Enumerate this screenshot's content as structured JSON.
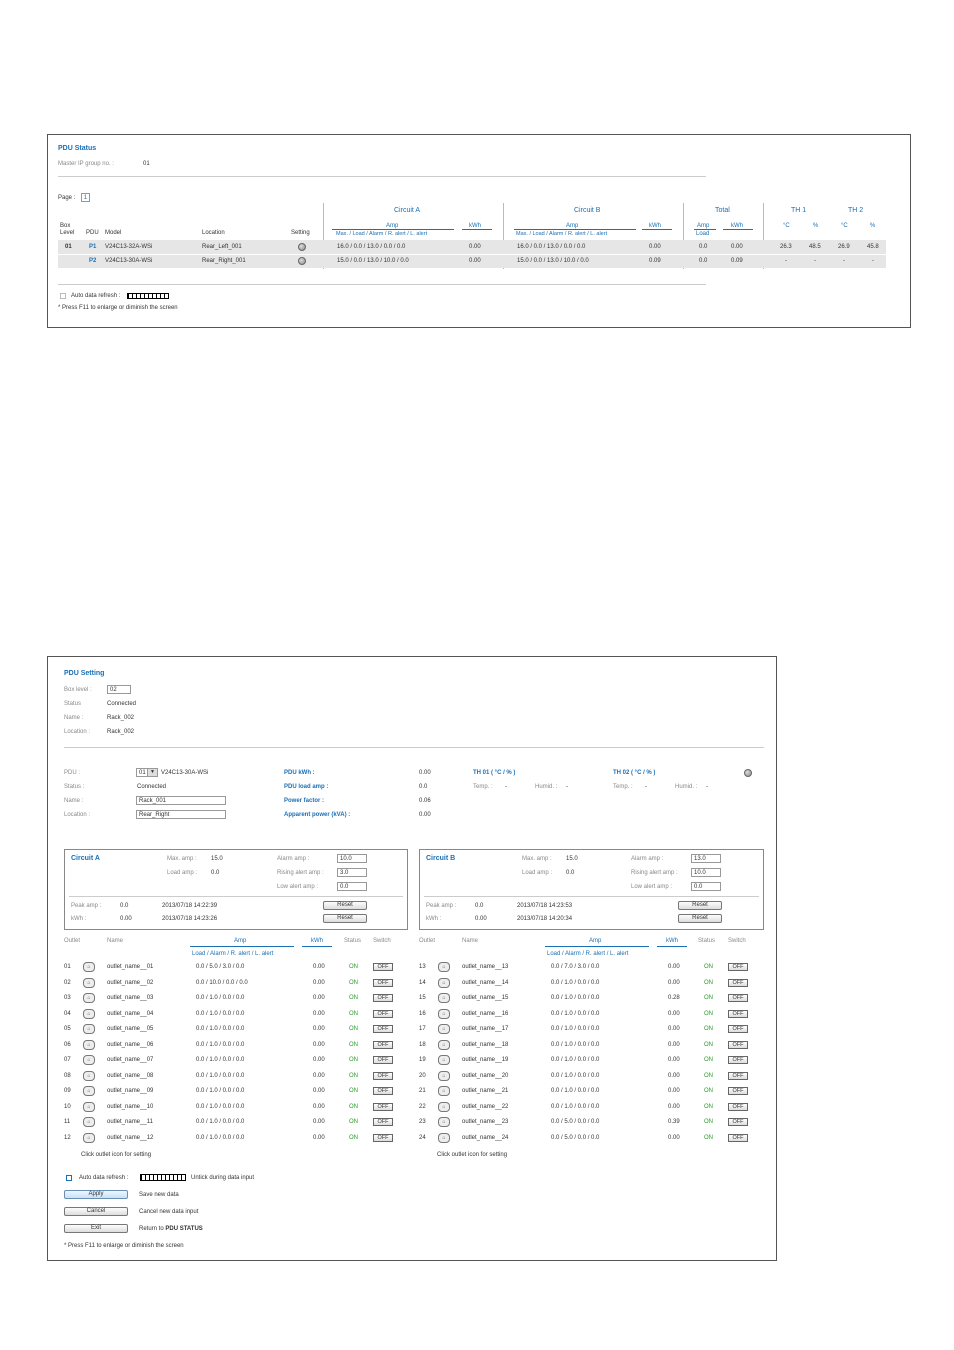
{
  "status": {
    "title": "PDU  Status",
    "master_ip_label": "Master  IP  group  no. :",
    "master_ip_value": "01",
    "page_label": "Page :",
    "page_value": "1",
    "circuit_a": "Circuit   A",
    "circuit_b": "Circuit   B",
    "total": "Total",
    "th1": "TH   1",
    "th2": "TH   2",
    "amp": "Amp",
    "kwh": "kWh",
    "amp_sub": "Max.  /  Load  / Alarm / R. alert / L. alert",
    "total_amp": "Amp",
    "total_load": "Load",
    "deg": "°C",
    "pct": "%",
    "col_box": "Box",
    "col_level": "Level",
    "col_pdu": "PDU",
    "col_model": "Model",
    "col_location": "Location",
    "col_setting": "Setting",
    "rows": [
      {
        "box": "01",
        "pdu": "P1",
        "model": "V24C13-32A-WSi",
        "location": "Rear_Left_001",
        "a_amp": "16.0   /   0.0   /  13.0   /   0.0   /   0.0",
        "a_kwh": "0.00",
        "b_amp": "16.0   /   0.0   /  13.0   /   0.0   /   0.0",
        "b_kwh": "0.00",
        "t_amp": "0.0",
        "t_kwh": "0.00",
        "th1c": "26.3",
        "th1p": "48.5",
        "th2c": "26.9",
        "th2p": "45.8"
      },
      {
        "box": "",
        "pdu": "P2",
        "model": "V24C13-30A-WSi",
        "location": "Rear_Right_001",
        "a_amp": "15.0   /   0.0   /  13.0   /  10.0   /   0.0",
        "a_kwh": "0.00",
        "b_amp": "15.0   /   0.0   /  13.0   /  10.0   /   0.0",
        "b_kwh": "0.09",
        "t_amp": "0.0",
        "t_kwh": "0.09",
        "th1c": "-",
        "th1p": "-",
        "th2c": "-",
        "th2p": "-"
      }
    ],
    "auto_refresh": "Auto data refresh :",
    "f11_note": "* Press F11 to enlarge or diminish the screen"
  },
  "setting": {
    "title": "PDU   Setting",
    "box_level_label": "Box level :",
    "box_level_value": "02",
    "status_label": "Status",
    "status_value": "Connected",
    "name_label": "Name :",
    "name_value": "Rack_002",
    "location_label": "Location :",
    "location_value": "Rack_002",
    "pdu_label": "PDU :",
    "pdu_select": "01",
    "pdu_model": "V24C13-30A-WSi",
    "pdu_status_label": "Status :",
    "pdu_status_value": "Connected",
    "pdu_name_label": "Name :",
    "pdu_name_value": "Rack_001",
    "pdu_location_label": "Location :",
    "pdu_location_value": "Rear_Right",
    "pdu_kwh_label": "PDU kWh :",
    "pdu_kwh_value": "0.00",
    "pdu_load_label": "PDU load amp :",
    "pdu_load_value": "0.0",
    "power_factor_label": "Power factor :",
    "power_factor_value": "0.06",
    "apparent_label": "Apparent power (kVA) :",
    "apparent_value": "0.00",
    "th01_label": "TH  01     ( °C   /   % )",
    "th02_label": "TH  02     ( °C   /   % )",
    "temp_label": "Temp. :",
    "temp_value": "-",
    "humid_label": "Humid. :",
    "humid_value": "-",
    "circuit_a": {
      "title": "Circuit A",
      "max_label": "Max. amp :",
      "max_value": "15.0",
      "load_label": "Load amp :",
      "load_value": "0.0",
      "alarm_label": "Alarm amp :",
      "alarm_value": "10.0",
      "rising_label": "Rising alert amp :",
      "rising_value": "3.0",
      "low_label": "Low alert amp :",
      "low_value": "0.0",
      "peak_label": "Peak amp :",
      "peak_value": "0.0",
      "peak_time": "2013/07/18 14:22:39",
      "kwh_label": "kWh :",
      "kwh_value": "0.00",
      "kwh_time": "2013/07/18 14:23:26",
      "reset": "Reset"
    },
    "circuit_b": {
      "title": "Circuit B",
      "max_label": "Max. amp :",
      "max_value": "15.0",
      "load_label": "Load amp :",
      "load_value": "0.0",
      "alarm_label": "Alarm amp :",
      "alarm_value": "13.0",
      "rising_label": "Rising alert amp :",
      "rising_value": "10.0",
      "low_label": "Low alert amp :",
      "low_value": "0.0",
      "peak_label": "Peak amp :",
      "peak_value": "0.0",
      "peak_time": "2013/07/18 14:23:53",
      "kwh_label": "kWh :",
      "kwh_value": "0.00",
      "kwh_time": "2013/07/18 14:20:34",
      "reset": "Reset"
    },
    "outlet_headers": {
      "outlet": "Outlet",
      "name": "Name",
      "amp": "Amp",
      "amp_sub": "Load / Alarm / R. alert / L. alert",
      "kwh": "kWh",
      "status": "Status",
      "switch": "Switch"
    },
    "outlets_left": [
      {
        "no": "01",
        "name": "outlet_name__01",
        "amp": "0.0   /   5.0   /   3.0   /   0.0",
        "kwh": "0.00",
        "status": "ON",
        "sw": "OFF"
      },
      {
        "no": "02",
        "name": "outlet_name__02",
        "amp": "0.0   /  10.0  /   0.0   /   0.0",
        "kwh": "0.00",
        "status": "ON",
        "sw": "OFF"
      },
      {
        "no": "03",
        "name": "outlet_name__03",
        "amp": "0.0   /   1.0   /   0.0   /   0.0",
        "kwh": "0.00",
        "status": "ON",
        "sw": "OFF"
      },
      {
        "no": "04",
        "name": "outlet_name__04",
        "amp": "0.0   /   1.0   /   0.0   /   0.0",
        "kwh": "0.00",
        "status": "ON",
        "sw": "OFF"
      },
      {
        "no": "05",
        "name": "outlet_name__05",
        "amp": "0.0   /   1.0   /   0.0   /   0.0",
        "kwh": "0.00",
        "status": "ON",
        "sw": "OFF"
      },
      {
        "no": "06",
        "name": "outlet_name__06",
        "amp": "0.0   /   1.0   /   0.0   /   0.0",
        "kwh": "0.00",
        "status": "ON",
        "sw": "OFF"
      },
      {
        "no": "07",
        "name": "outlet_name__07",
        "amp": "0.0   /   1.0   /   0.0   /   0.0",
        "kwh": "0.00",
        "status": "ON",
        "sw": "OFF"
      },
      {
        "no": "08",
        "name": "outlet_name__08",
        "amp": "0.0   /   1.0   /   0.0   /   0.0",
        "kwh": "0.00",
        "status": "ON",
        "sw": "OFF"
      },
      {
        "no": "09",
        "name": "outlet_name__09",
        "amp": "0.0   /   1.0   /   0.0   /   0.0",
        "kwh": "0.00",
        "status": "ON",
        "sw": "OFF"
      },
      {
        "no": "10",
        "name": "outlet_name__10",
        "amp": "0.0   /   1.0   /   0.0   /   0.0",
        "kwh": "0.00",
        "status": "ON",
        "sw": "OFF"
      },
      {
        "no": "11",
        "name": "outlet_name__11",
        "amp": "0.0   /   1.0   /   0.0   /   0.0",
        "kwh": "0.00",
        "status": "ON",
        "sw": "OFF"
      },
      {
        "no": "12",
        "name": "outlet_name__12",
        "amp": "0.0   /   1.0   /   0.0   /   0.0",
        "kwh": "0.00",
        "status": "ON",
        "sw": "OFF"
      }
    ],
    "outlets_right": [
      {
        "no": "13",
        "name": "outlet_name__13",
        "amp": "0.0   /   7.0   /   3.0   /   0.0",
        "kwh": "0.00",
        "status": "ON",
        "sw": "OFF"
      },
      {
        "no": "14",
        "name": "outlet_name__14",
        "amp": "0.0   /   1.0   /   0.0   /   0.0",
        "kwh": "0.00",
        "status": "ON",
        "sw": "OFF"
      },
      {
        "no": "15",
        "name": "outlet_name__15",
        "amp": "0.0   /   1.0   /   0.0   /   0.0",
        "kwh": "0.28",
        "status": "ON",
        "sw": "OFF"
      },
      {
        "no": "16",
        "name": "outlet_name__16",
        "amp": "0.0   /   1.0   /   0.0   /   0.0",
        "kwh": "0.00",
        "status": "ON",
        "sw": "OFF"
      },
      {
        "no": "17",
        "name": "outlet_name__17",
        "amp": "0.0   /   1.0   /   0.0   /   0.0",
        "kwh": "0.00",
        "status": "ON",
        "sw": "OFF"
      },
      {
        "no": "18",
        "name": "outlet_name__18",
        "amp": "0.0   /   1.0   /   0.0   /   0.0",
        "kwh": "0.00",
        "status": "ON",
        "sw": "OFF"
      },
      {
        "no": "19",
        "name": "outlet_name__19",
        "amp": "0.0   /   1.0   /   0.0   /   0.0",
        "kwh": "0.00",
        "status": "ON",
        "sw": "OFF"
      },
      {
        "no": "20",
        "name": "outlet_name__20",
        "amp": "0.0   /   1.0   /   0.0   /   0.0",
        "kwh": "0.00",
        "status": "ON",
        "sw": "OFF"
      },
      {
        "no": "21",
        "name": "outlet_name__21",
        "amp": "0.0   /   1.0   /   0.0   /   0.0",
        "kwh": "0.00",
        "status": "ON",
        "sw": "OFF"
      },
      {
        "no": "22",
        "name": "outlet_name__22",
        "amp": "0.0   /   1.0   /   0.0   /   0.0",
        "kwh": "0.00",
        "status": "ON",
        "sw": "OFF"
      },
      {
        "no": "23",
        "name": "outlet_name__23",
        "amp": "0.0   /   5.0   /   0.0   /   0.0",
        "kwh": "0.39",
        "status": "ON",
        "sw": "OFF"
      },
      {
        "no": "24",
        "name": "outlet_name__24",
        "amp": "0.0   /   5.0   /   0.0   /   0.0",
        "kwh": "0.00",
        "status": "ON",
        "sw": "OFF"
      }
    ],
    "click_note": "Click outlet icon for setting",
    "auto_refresh": "Auto data refresh :",
    "untick_note": "Untick during data input",
    "apply": "Apply",
    "apply_note": "Save new data",
    "cancel": "Cancel",
    "cancel_note": "Cancel new data input",
    "exit": "Exit",
    "exit_note_prefix": "Return to ",
    "exit_note_bold": "PDU STATUS",
    "f11_note": "* Press F11 to enlarge or diminish the screen"
  },
  "colors": {
    "accent": "#1a6fb5",
    "on": "#2a9a2a",
    "row_bg": "#e6e6e6"
  }
}
